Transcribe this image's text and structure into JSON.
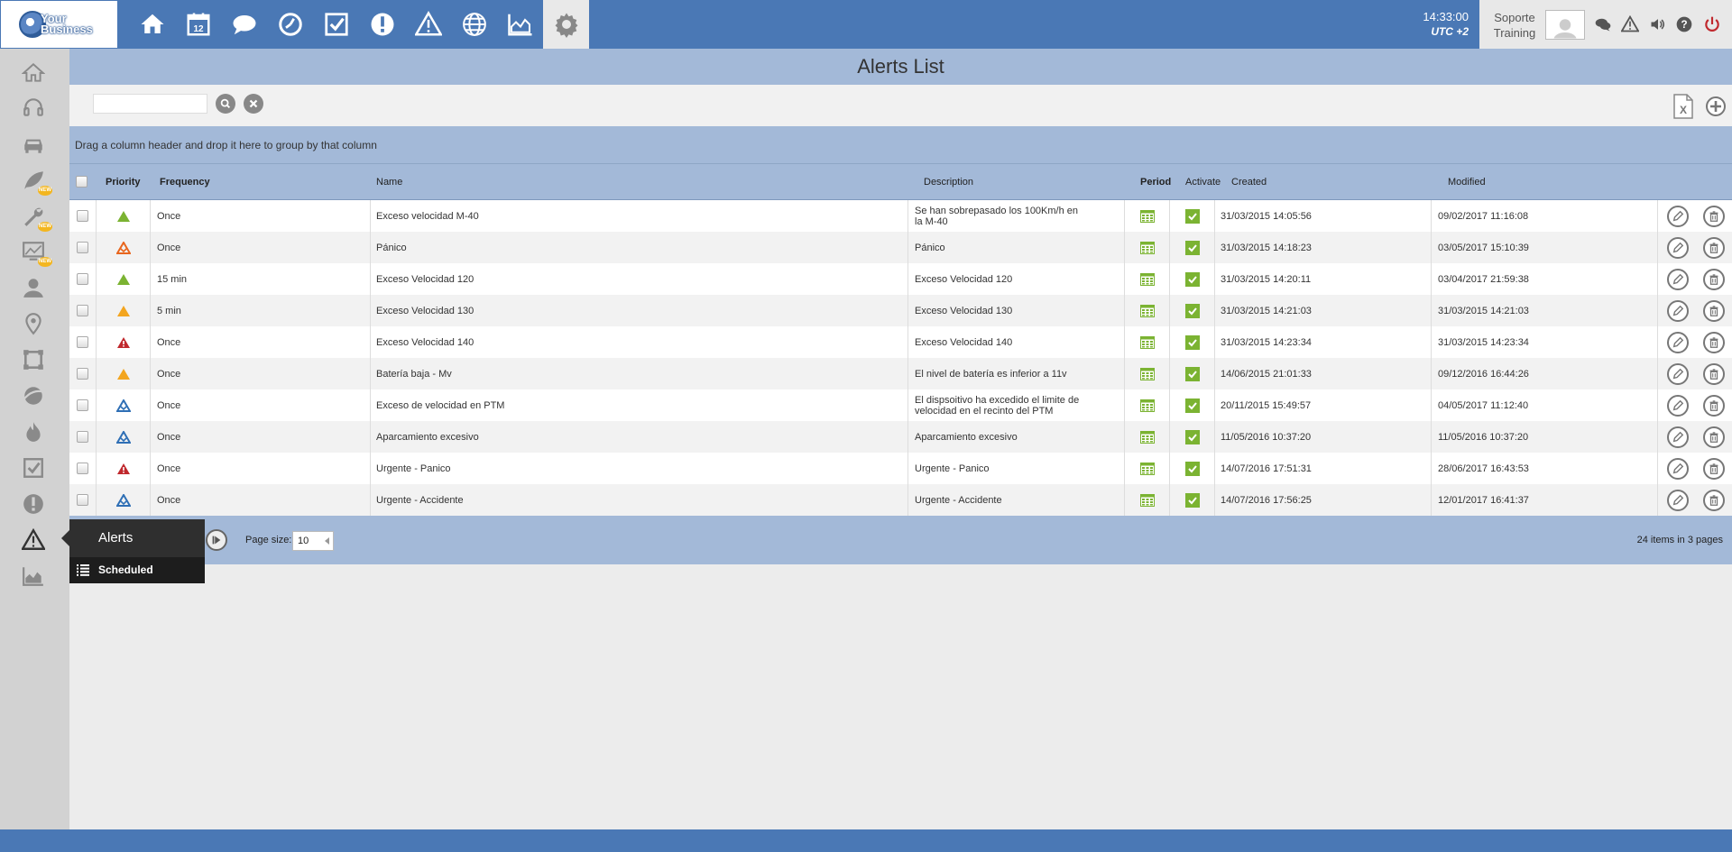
{
  "logo": {
    "text_line1": "Your",
    "text_line2": "Business"
  },
  "topnav": [
    {
      "name": "home-icon"
    },
    {
      "name": "calendar-icon",
      "text": "12"
    },
    {
      "name": "chat-bubble-icon"
    },
    {
      "name": "clock-icon"
    },
    {
      "name": "checkbox-icon"
    },
    {
      "name": "exclamation-icon"
    },
    {
      "name": "warning-icon"
    },
    {
      "name": "globe-icon"
    },
    {
      "name": "area-chart-icon"
    },
    {
      "name": "gear-icon"
    }
  ],
  "clock": {
    "time": "14:33:00",
    "timezone": "UTC +2"
  },
  "user": {
    "line1": "Soporte",
    "line2": "Training"
  },
  "page": {
    "title": "Alerts List"
  },
  "search": {
    "placeholder": ""
  },
  "groupbar": {
    "text": "Drag a column header and drop it here to group by that column"
  },
  "columns": {
    "priority": "Priority",
    "frequency": "Frequency",
    "name": "Name",
    "description": "Description",
    "period": "Period",
    "activate": "Activate",
    "created": "Created",
    "modified": "Modified"
  },
  "rows": [
    {
      "priority": "green",
      "frequency": "Once",
      "name": "Exceso velocidad M-40",
      "description": "Se han sobrepasado los 100Km/h en la M-40",
      "created": "31/03/2015 14:05:56",
      "modified": "09/02/2017 11:16:08"
    },
    {
      "priority": "orange-outline",
      "frequency": "Once",
      "name": "Pánico",
      "description": "Pánico",
      "created": "31/03/2015 14:18:23",
      "modified": "03/05/2017 15:10:39"
    },
    {
      "priority": "green",
      "frequency": "15 min",
      "name": "Exceso Velocidad 120",
      "description": "Exceso Velocidad 120",
      "created": "31/03/2015 14:20:11",
      "modified": "03/04/2017 21:59:38"
    },
    {
      "priority": "yellow",
      "frequency": "5 min",
      "name": "Exceso Velocidad 130",
      "description": "Exceso Velocidad 130",
      "created": "31/03/2015 14:21:03",
      "modified": "31/03/2015 14:21:03"
    },
    {
      "priority": "red",
      "frequency": "Once",
      "name": "Exceso Velocidad 140",
      "description": "Exceso Velocidad 140",
      "created": "31/03/2015 14:23:34",
      "modified": "31/03/2015 14:23:34"
    },
    {
      "priority": "yellow",
      "frequency": "Once",
      "name": "Batería baja - Mv",
      "description": "El nivel de batería es inferior a 11v",
      "created": "14/06/2015 21:01:33",
      "modified": "09/12/2016 16:44:26"
    },
    {
      "priority": "blue",
      "frequency": "Once",
      "name": "Exceso de velocidad en PTM",
      "description": "El dispsoitivo ha excedido el limite de velocidad en el recinto del PTM",
      "created": "20/11/2015 15:49:57",
      "modified": "04/05/2017 11:12:40"
    },
    {
      "priority": "blue",
      "frequency": "Once",
      "name": "Aparcamiento excesivo",
      "description": "Aparcamiento excesivo",
      "created": "11/05/2016 10:37:20",
      "modified": "11/05/2016 10:37:20"
    },
    {
      "priority": "red",
      "frequency": "Once",
      "name": "Urgente - Panico",
      "description": "Urgente - Panico",
      "created": "14/07/2016 17:51:31",
      "modified": "28/06/2017 16:43:53"
    },
    {
      "priority": "blue",
      "frequency": "Once",
      "name": "Urgente - Accidente",
      "description": "Urgente - Accidente",
      "created": "14/07/2016 17:56:25",
      "modified": "12/01/2017 16:41:37"
    }
  ],
  "pager": {
    "page_size_label": "Page size:",
    "page_size": "10",
    "info": "24 items in 3 pages"
  },
  "flyout": {
    "title": "Alerts",
    "item": "Scheduled"
  },
  "sidebar": [
    {
      "name": "home-icon"
    },
    {
      "name": "headset-icon"
    },
    {
      "name": "car-icon"
    },
    {
      "name": "leaf-icon",
      "badge": "NEW"
    },
    {
      "name": "wrench-icon",
      "badge": "NEW"
    },
    {
      "name": "monitor-icon",
      "badge": "NEW"
    },
    {
      "name": "user-icon"
    },
    {
      "name": "map-pin-icon"
    },
    {
      "name": "square-area-icon"
    },
    {
      "name": "planet-icon"
    },
    {
      "name": "fire-icon"
    },
    {
      "name": "checkbox-icon"
    },
    {
      "name": "exclamation-icon"
    },
    {
      "name": "warning-icon"
    },
    {
      "name": "area-chart-icon"
    }
  ],
  "colors": {
    "topbar": "#4a78b5",
    "titlebar": "#a3b9d8",
    "sidebar": "#d2d2d2",
    "check": "#7bb332"
  }
}
